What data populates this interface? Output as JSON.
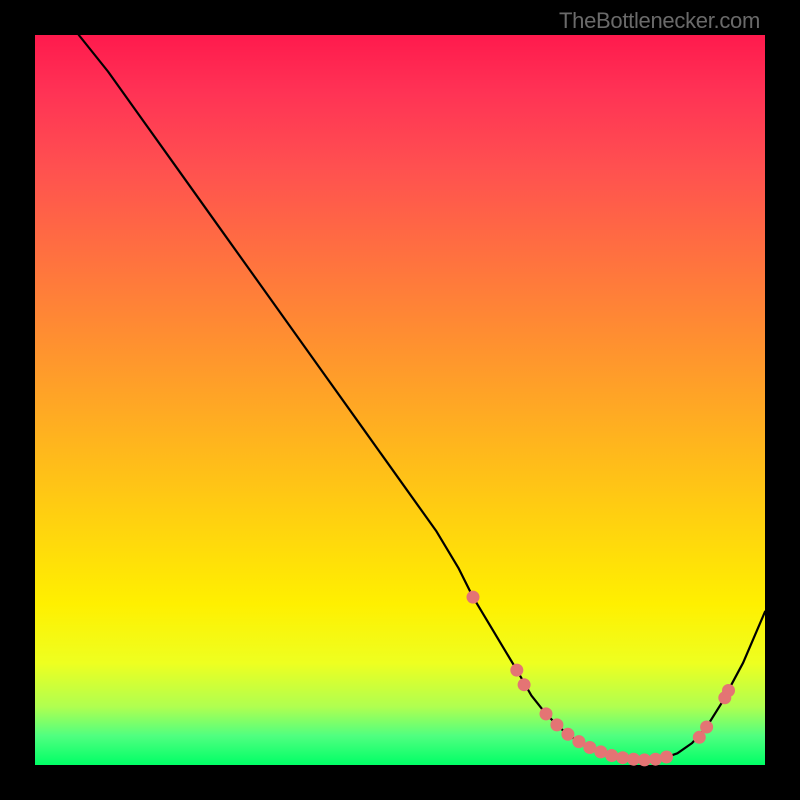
{
  "watermark": "TheBottlenecker.com",
  "chart_data": {
    "type": "line",
    "title": "",
    "xlabel": "",
    "ylabel": "",
    "xlim": [
      0,
      100
    ],
    "ylim": [
      0,
      100
    ],
    "grid": false,
    "series": [
      {
        "name": "curve",
        "x": [
          6,
          10,
          15,
          20,
          25,
          30,
          35,
          40,
          45,
          50,
          55,
          58,
          60,
          63,
          66,
          68,
          70,
          72,
          74,
          76,
          78,
          80,
          82,
          84,
          86,
          88,
          90,
          92,
          94,
          97,
          100
        ],
        "y": [
          100,
          95,
          88,
          81,
          74,
          67,
          60,
          53,
          46,
          39,
          32,
          27,
          23,
          18,
          13,
          9.5,
          7,
          5,
          3.5,
          2.4,
          1.6,
          1.1,
          0.8,
          0.7,
          0.9,
          1.6,
          3,
          5.2,
          8.4,
          14,
          21
        ],
        "annotated_points": [
          {
            "x": 60,
            "y": 23
          },
          {
            "x": 66,
            "y": 13
          },
          {
            "x": 67,
            "y": 11
          },
          {
            "x": 70,
            "y": 7
          },
          {
            "x": 71.5,
            "y": 5.5
          },
          {
            "x": 73,
            "y": 4.2
          },
          {
            "x": 74.5,
            "y": 3.2
          },
          {
            "x": 76,
            "y": 2.4
          },
          {
            "x": 77.5,
            "y": 1.8
          },
          {
            "x": 79,
            "y": 1.3
          },
          {
            "x": 80.5,
            "y": 1.0
          },
          {
            "x": 82,
            "y": 0.8
          },
          {
            "x": 83.5,
            "y": 0.7
          },
          {
            "x": 85,
            "y": 0.8
          },
          {
            "x": 86.5,
            "y": 1.1
          },
          {
            "x": 91,
            "y": 3.8
          },
          {
            "x": 92,
            "y": 5.2
          },
          {
            "x": 94.5,
            "y": 9.2
          },
          {
            "x": 95,
            "y": 10.2
          }
        ]
      }
    ],
    "background_gradient": {
      "top": "#ff1a4d",
      "bottom": "#00ff66"
    },
    "description": "A curve starting at top-left, descending almost linearly to a minimum near x≈83, then rising again toward the right edge. Salmon-colored dots highlight the valley region."
  }
}
